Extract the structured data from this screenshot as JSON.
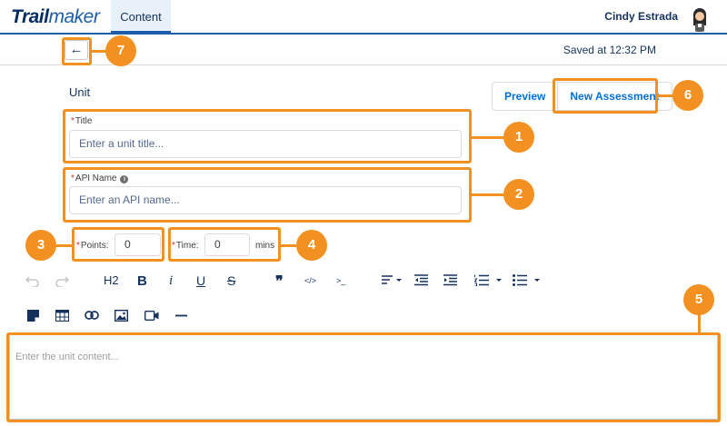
{
  "nav": {
    "logo_a": "Trail",
    "logo_b": "maker",
    "tab": "Content",
    "user": "Cindy Estrada"
  },
  "subheader": {
    "back_glyph": "←",
    "saved": "Saved at 12:32 PM"
  },
  "form": {
    "section": "Unit",
    "preview_label": "Preview",
    "new_assessment_label": "New Assessment",
    "required_mark": "*",
    "title_label": "Title",
    "title_placeholder": "Enter a unit title...",
    "api_label": "API Name",
    "api_info": "i",
    "api_placeholder": "Enter an API name...",
    "points_label": "Points:",
    "points_value": "0",
    "time_label": "Time:",
    "time_value": "0",
    "time_unit": "mins"
  },
  "toolbar": {
    "heading": "H2",
    "bold": "B",
    "italic": "i",
    "underline": "U",
    "strike": "S",
    "quote": "❞",
    "code": "</>",
    "terminal": ">_"
  },
  "editor": {
    "placeholder": "Enter the unit content..."
  },
  "callouts": [
    "1",
    "2",
    "3",
    "4",
    "5",
    "6",
    "7"
  ],
  "icons": [
    "avatar-icon",
    "back-arrow-icon",
    "info-icon",
    "undo-icon",
    "redo-icon",
    "align-icon",
    "outdent-icon",
    "indent-icon",
    "numbered-list-icon",
    "bulleted-list-icon",
    "note-icon",
    "table-icon",
    "link-icon",
    "image-icon",
    "video-icon",
    "divider-icon"
  ],
  "colors": {
    "accent": "#f29122",
    "brand": "#1b5dab",
    "link": "#0070d2"
  }
}
